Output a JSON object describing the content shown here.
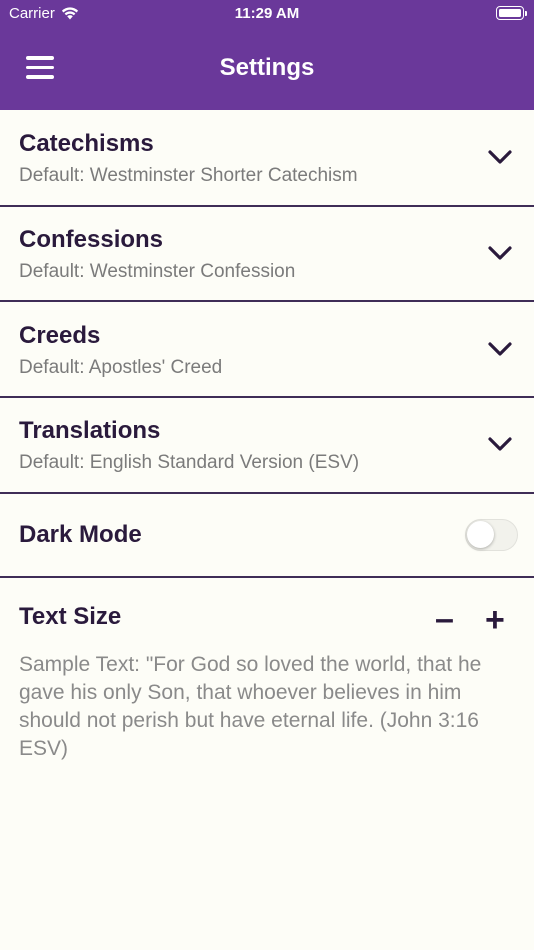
{
  "status_bar": {
    "carrier": "Carrier",
    "time": "11:29 AM"
  },
  "header": {
    "title": "Settings"
  },
  "settings": [
    {
      "title": "Catechisms",
      "subtitle": "Default: Westminster Shorter Catechism"
    },
    {
      "title": "Confessions",
      "subtitle": "Default: Westminster Confession"
    },
    {
      "title": "Creeds",
      "subtitle": "Default: Apostles' Creed"
    },
    {
      "title": "Translations",
      "subtitle": "Default: English Standard Version (ESV)"
    }
  ],
  "dark_mode": {
    "label": "Dark Mode",
    "enabled": false
  },
  "text_size": {
    "label": "Text Size",
    "decrease_label": "–",
    "increase_label": "+",
    "sample": "Sample Text: \"For God so loved the world, that he gave his only Son, that whoever believes in him should not perish but have eternal life. (John 3:16 ESV)"
  },
  "colors": {
    "header": "#6a389a",
    "text": "#2a1a3c",
    "subtitle": "#7b7b7b",
    "background": "#fdfdf7"
  }
}
